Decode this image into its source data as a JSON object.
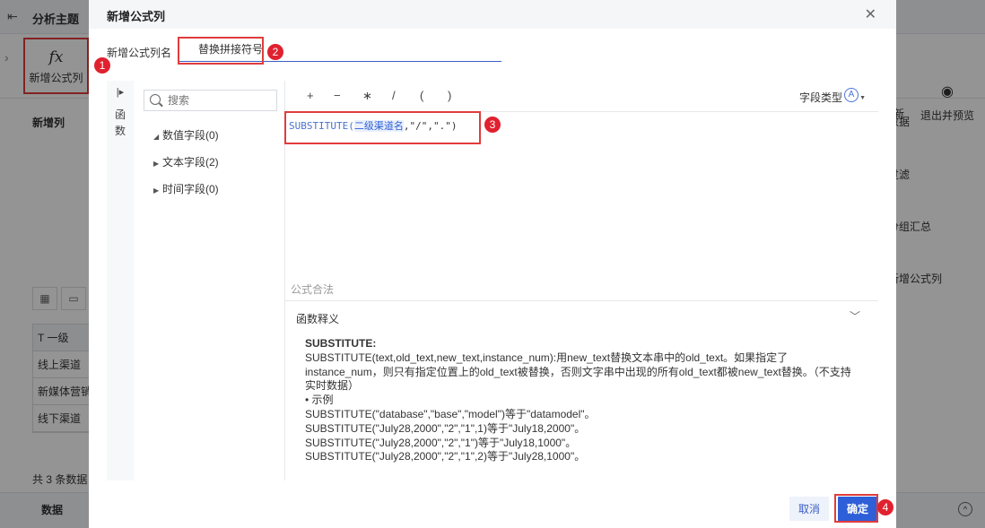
{
  "background": {
    "top_title": "分析主题",
    "toolbar": {
      "fx_label": "新增公式列",
      "right_button_1": "新",
      "right_button_2": "退出并预览"
    },
    "left_title": "新增列",
    "right_list": [
      "数据",
      "过滤",
      "分组汇总",
      "新增公式列"
    ],
    "table": {
      "header": "一级",
      "rows": [
        "线上渠道",
        "新媒体营销",
        "线下渠道"
      ]
    },
    "count": "共 3 条数据",
    "bottom_label": "数据"
  },
  "dialog": {
    "title": "新增公式列",
    "name_label": "新增公式列名",
    "name_value": "替换拼接符号",
    "fn_strip_label": "函数",
    "search_placeholder": "搜索",
    "tree": [
      "数值字段(0)",
      "文本字段(2)",
      "时间字段(0)"
    ],
    "operators": [
      "+",
      "−",
      "∗",
      "/",
      "(",
      ")"
    ],
    "field_type_label": "字段类型",
    "formula": {
      "fn": "SUBSTITUTE(",
      "field": "二级渠道名",
      "args": ",\"/\",\".\")"
    },
    "valid_text": "公式合法",
    "desc_title": "函数释义",
    "desc_lines": [
      "SUBSTITUTE:",
      "SUBSTITUTE(text,old_text,new_text,instance_num):用new_text替换文本串中的old_text。如果指定了instance_num，则只有指定位置上的old_text被替换，否则文字串中出现的所有old_text都被new_text替换。（不支持实时数据）",
      "• 示例",
      "SUBSTITUTE(\"database\",\"base\",\"model\")等于\"datamodel\"。",
      "SUBSTITUTE(\"July28,2000\",\"2\",\"1\",1)等于\"July18,2000\"。",
      "SUBSTITUTE(\"July28,2000\",\"2\",\"1\")等于\"July18,1000\"。",
      "SUBSTITUTE(\"July28,2000\",\"2\",\"1\",2)等于\"July28,1000\"。"
    ],
    "cancel_label": "取消",
    "ok_label": "确定"
  },
  "badges": [
    "1",
    "2",
    "3",
    "4"
  ],
  "colors": {
    "annotation_red": "#e03c3c",
    "badge_red": "#e0212f",
    "primary_blue": "#2f5fd8"
  }
}
